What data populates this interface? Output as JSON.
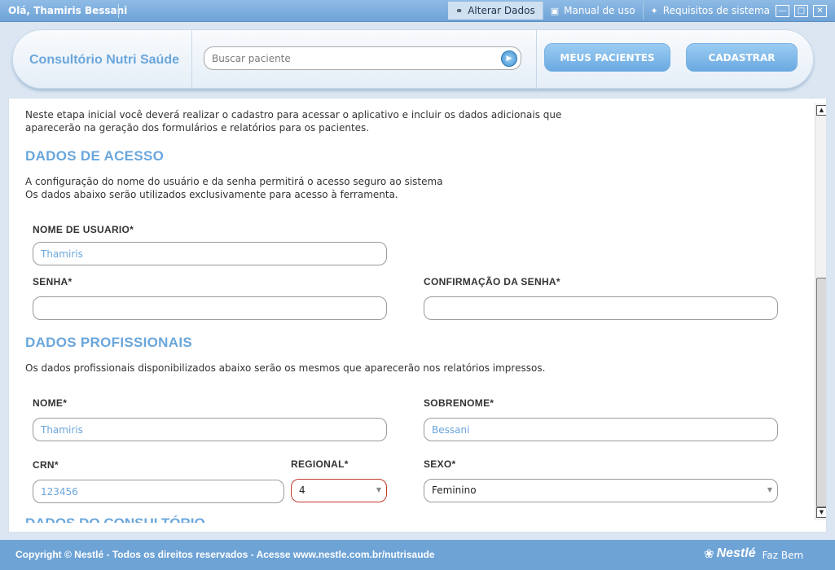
{
  "topbar": {
    "greeting": "Olá, Thamiris Bessani",
    "links": [
      {
        "label": "Alterar Dados",
        "icon": "link-icon",
        "active": true
      },
      {
        "label": "Manual de uso",
        "icon": "book-icon",
        "active": false
      },
      {
        "label": "Requisitos de sistema",
        "icon": "tag-icon",
        "active": false
      }
    ],
    "window_buttons": [
      "minimize",
      "maximize",
      "close"
    ]
  },
  "header": {
    "brand": "Consultório Nutri Saúde",
    "search": {
      "placeholder": "Buscar paciente",
      "value": ""
    },
    "buttons": {
      "patients": "MEUS PACIENTES",
      "register": "CADASTRAR"
    }
  },
  "main": {
    "intro": [
      "Neste etapa inicial você deverá realizar o cadastro para acessar o aplicativo e incluir os dados adicionais que",
      "aparecerão na geração dos formulários e relatórios para os pacientes."
    ],
    "access": {
      "title": "DADOS DE ACESSO",
      "desc": [
        "A configuração do nome do usuário e da senha permitirá o acesso seguro ao sistema",
        "Os dados abaixo serão utilizados exclusivamente para acesso à ferramenta."
      ],
      "username_label": "NOME DE USUARIO*",
      "username_value": "Thamiris",
      "password_label": "SENHA*",
      "password_value": "",
      "confirm_label": "CONFIRMAÇÃO DA SENHA*",
      "confirm_value": ""
    },
    "professional": {
      "title": "DADOS PROFISSIONAIS",
      "desc": "Os dados profissionais disponibilizados abaixo serão os mesmos que aparecerão nos relatórios impressos.",
      "name_label": "NOME*",
      "name_value": "Thamiris",
      "surname_label": "SOBRENOME*",
      "surname_value": "Bessani",
      "crn_label": "CRN*",
      "crn_value": "123456",
      "regional_label": "REGIONAL*",
      "regional_value": "4",
      "sex_label": "SEXO*",
      "sex_value": "Feminino"
    },
    "next_section_title": "DADOS DO CONSULTÓRIO"
  },
  "footer": {
    "copyright": "Copyright © Nestlé - Todos os direitos reservados - Acesse www.nestle.com.br/nutrisaude",
    "logo_name": "Nestlé",
    "logo_tagline": "Faz Bem"
  },
  "colors": {
    "accent": "#6aa6dc",
    "topbar": "#6ea3d6",
    "button": "#7fb8e8",
    "error_border": "#c0392b"
  }
}
